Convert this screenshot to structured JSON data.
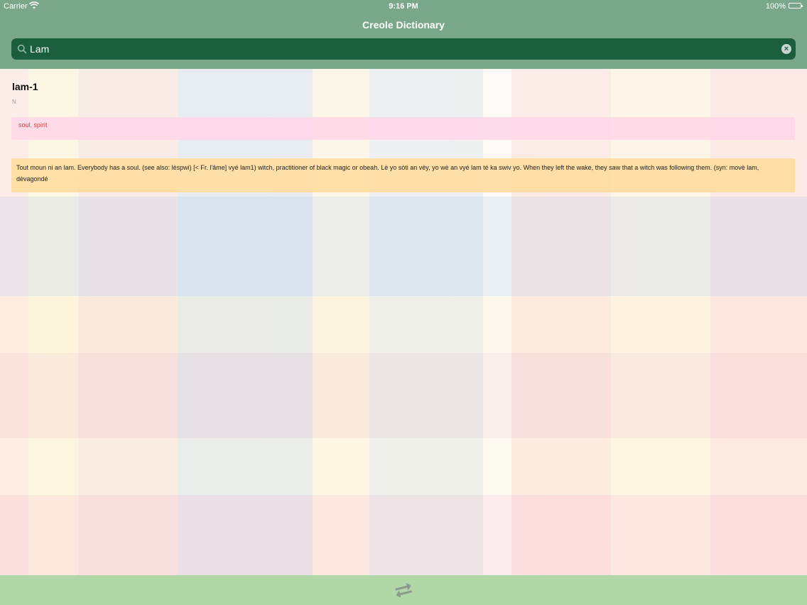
{
  "status_bar": {
    "carrier": "Carrier",
    "time": "9:16 PM",
    "battery": "100%"
  },
  "nav": {
    "title": "Creole Dictionary"
  },
  "search": {
    "value": "Lam"
  },
  "entry": {
    "word": "lam-1",
    "part_of_speech": "N",
    "translation": "soul, spirit",
    "definition": "Tout moun ni an lam. Everybody has a soul. (see also: lèspwi) [< Fr. l'âme] vyé lam1) witch, practitioner of black magic or obeah. Lè yo sòti an vèy, yo wè an vyé lam té ka swiv yo. When they left the wake, they saw that a witch was following them. (syn: movè lam, dèvagondé"
  },
  "icons": {
    "search": "search-icon",
    "clear": "clear-icon",
    "swap": "swap-arrows-icon",
    "wifi": "wifi-icon",
    "battery": "battery-icon"
  },
  "colors": {
    "header": "#7aa68a",
    "search_field": "#1b5e3e",
    "translation_bg": "#ffd6e8",
    "translation_text": "#e0413f",
    "definition_bg": "#ffdd9e",
    "tab_bar": "#b2d7a7"
  }
}
